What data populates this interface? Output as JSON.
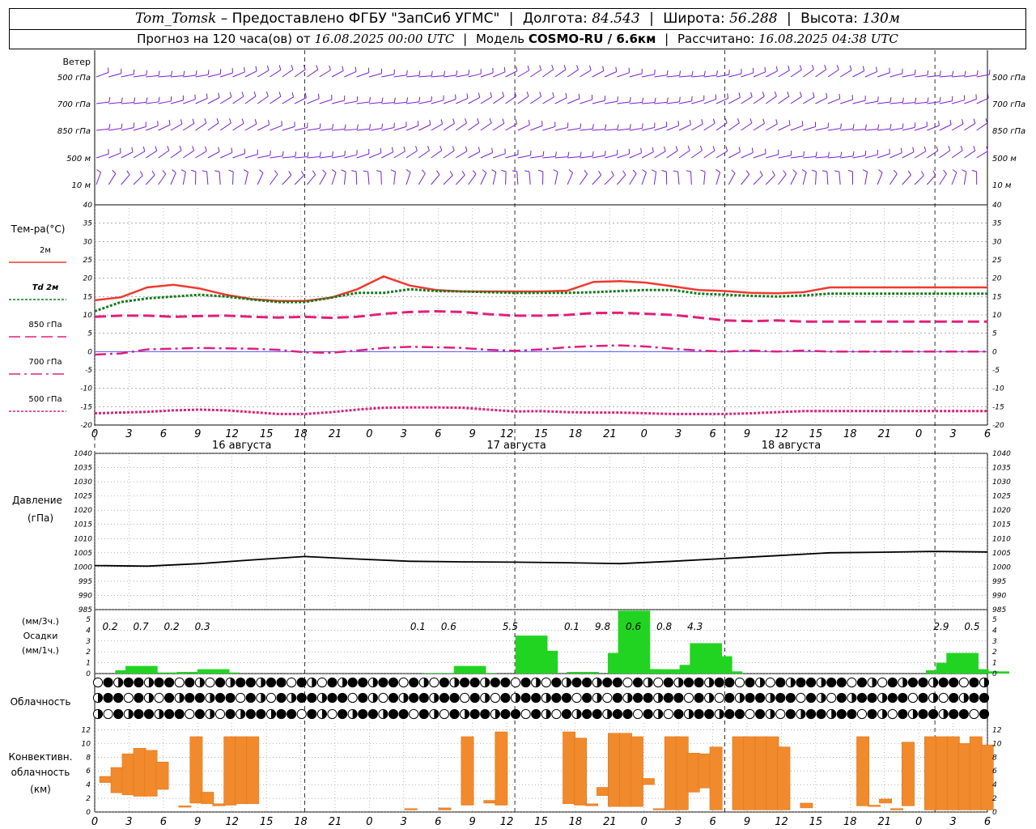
{
  "header": {
    "station": "Tom_Tomsk",
    "provider": "– Предоставлено ФГБУ \"ЗапСиб УГМС\"",
    "lon_label": "Долгота:",
    "lon": "84.543",
    "lat_label": "Широта:",
    "lat": "56.288",
    "alt_label": "Высота:",
    "alt": "130м",
    "forecast_text": "Прогноз на 120 часа(ов) от",
    "forecast_start": "16.08.2025 00:00 UTC",
    "model_label": "Модель",
    "model": "COSMO-RU / 6.6км",
    "calc_label": "Рассчитано:",
    "calc_time": "16.08.2025 04:38 UTC"
  },
  "panels": {
    "wind_label": "Ветер",
    "wind_levels": [
      "500 гПа",
      "700 гПа",
      "850 гПа",
      "500 м",
      "10  м"
    ],
    "temp_label": "Тем-ра(°C)",
    "temp_legend": [
      "2м",
      "Td  2м",
      "850 гПа",
      "700 гПа",
      "500 гПа"
    ],
    "pressure_label_1": "Давление",
    "pressure_label_2": "(гПа)",
    "precip_label_1": "(мм/3ч.)",
    "precip_label_2": "Осадки",
    "precip_label_3": "(мм/1ч.)",
    "cloud_label": "Облачность",
    "conv_label_1": "Конвективн.",
    "conv_label_2": "облачность",
    "conv_label_3": "(км)"
  },
  "colors": {
    "wind": "#7a1fd0",
    "t2m": "#ef3a2f",
    "td2m": "#157a1c",
    "t850": "#e0207a",
    "t700": "#e0207a",
    "t500": "#e0207a",
    "pressure": "#000000",
    "precip": "#22d422",
    "convective": "#f08a2c",
    "grid": "#808080",
    "zero_line": "#3b3bff"
  },
  "time_axis": {
    "tick_labels": [
      "0",
      "3",
      "6",
      "9",
      "12",
      "15",
      "18",
      "21",
      "0",
      "3",
      "6",
      "9",
      "12",
      "15",
      "18",
      "21",
      "0",
      "3",
      "6",
      "9",
      "12",
      "15",
      "18",
      "21",
      "0",
      "3",
      "6"
    ],
    "day_labels": [
      "16 августа",
      "17 августа",
      "18 августа"
    ]
  },
  "chart_data": [
    {
      "type": "line",
      "title": "Тем-ра(°C)",
      "x_hours": [
        0,
        3,
        6,
        9,
        12,
        15,
        18,
        21,
        24,
        27,
        30,
        33,
        36,
        39,
        42,
        45,
        48,
        51,
        54,
        57,
        60,
        63,
        66,
        69,
        72,
        75,
        78,
        81,
        84,
        87,
        90,
        93,
        96,
        99,
        102
      ],
      "ylim": [
        -20,
        40
      ],
      "yticks": [
        40,
        35,
        30,
        25,
        20,
        15,
        10,
        5,
        0,
        -5,
        -10,
        -15,
        -20
      ],
      "series": [
        {
          "name": "2м",
          "values": [
            14,
            14.8,
            17.5,
            18.2,
            17.2,
            15.5,
            14.3,
            13.8,
            13.8,
            14.7,
            17.0,
            20.5,
            18.0,
            16.8,
            16.4,
            16.4,
            16.4,
            16.4,
            16.6,
            19.0,
            19.2,
            18.8,
            17.8,
            16.8,
            16.5,
            16.0,
            15.9,
            16.2,
            17.5,
            17.5,
            17.5,
            17.5,
            17.5,
            17.5,
            17.5
          ]
        },
        {
          "name": "Td  2м",
          "values": [
            11,
            13.5,
            14.5,
            15.0,
            15.5,
            15.0,
            14.2,
            13.5,
            13.5,
            14.7,
            16.0,
            16.0,
            17.0,
            16.5,
            16.4,
            16.2,
            16.0,
            16.0,
            16.0,
            16.2,
            16.5,
            16.8,
            16.8,
            15.8,
            15.5,
            15.2,
            15.0,
            15.3,
            15.8,
            15.8,
            15.8,
            15.8,
            15.8,
            15.8,
            15.8
          ]
        },
        {
          "name": "850 гПа",
          "values": [
            9.5,
            9.8,
            9.8,
            9.5,
            9.7,
            9.8,
            9.5,
            9.3,
            9.5,
            9.2,
            9.5,
            10.3,
            10.8,
            11.0,
            10.8,
            10.2,
            9.8,
            9.8,
            10.0,
            10.5,
            10.6,
            10.3,
            10.0,
            9.3,
            8.5,
            8.3,
            8.5,
            8.2,
            8.2,
            8.2,
            8.2,
            8.2,
            8.2,
            8.2,
            8.2
          ]
        },
        {
          "name": "700 гПа",
          "values": [
            -0.8,
            -0.5,
            0.6,
            0.8,
            1.0,
            0.9,
            0.8,
            0.5,
            -0.2,
            -0.3,
            0.3,
            1.0,
            1.3,
            1.2,
            1.0,
            0.5,
            0.2,
            0.6,
            1.2,
            1.5,
            1.7,
            1.4,
            0.8,
            0.3,
            0,
            0.3,
            0,
            0.3,
            0,
            0,
            0,
            0,
            0,
            0,
            0
          ]
        },
        {
          "name": "500 гПа",
          "values": [
            -16.8,
            -16.6,
            -16.4,
            -16.0,
            -15.8,
            -16.0,
            -16.5,
            -17.0,
            -17.0,
            -16.5,
            -15.8,
            -15.3,
            -15.2,
            -15.2,
            -15.3,
            -15.8,
            -16.3,
            -16.2,
            -16.5,
            -16.6,
            -16.6,
            -16.8,
            -17.0,
            -17.0,
            -17.0,
            -16.8,
            -16.5,
            -16.2,
            -16.2,
            -16.2,
            -16.2,
            -16.2,
            -16.2,
            -16.2,
            -16.2
          ]
        }
      ]
    },
    {
      "type": "line",
      "title": "Давление",
      "x_hours": [
        0,
        6,
        12,
        18,
        24,
        30,
        36,
        42,
        48,
        54,
        60,
        66,
        72,
        78,
        84,
        90,
        96,
        102
      ],
      "ylim": [
        985,
        1040
      ],
      "yticks": [
        1040,
        1035,
        1030,
        1025,
        1020,
        1015,
        1010,
        1005,
        1000,
        995,
        990,
        985
      ],
      "series": [
        {
          "name": "Давление",
          "values": [
            1000.5,
            1000.3,
            1001.2,
            1002.5,
            1003.7,
            1002.8,
            1002.0,
            1001.8,
            1001.7,
            1001.5,
            1001.2,
            1002.0,
            1003.0,
            1004.0,
            1005.0,
            1005.2,
            1005.5,
            1005.3
          ]
        }
      ]
    },
    {
      "type": "bar",
      "title": "Осадки",
      "ylim": [
        0,
        5
      ],
      "yticks": [
        5,
        4,
        3,
        2,
        1,
        0
      ],
      "bars_mm_per_hour": [
        {
          "hour": 2,
          "value": 0.3
        },
        {
          "hour": 3,
          "value": 0.7
        },
        {
          "hour": 4,
          "value": 0.1
        },
        {
          "hour": 7,
          "value": 0.1
        },
        {
          "hour": 8,
          "value": 0.15
        },
        {
          "hour": 9,
          "value": 0.1
        },
        {
          "hour": 10,
          "value": 0.4
        },
        {
          "hour": 11,
          "value": 0.1
        },
        {
          "hour": 32,
          "value": 0.05
        },
        {
          "hour": 35,
          "value": 0.7
        },
        {
          "hour": 36,
          "value": 0.05
        },
        {
          "hour": 41,
          "value": 3.5
        },
        {
          "hour": 42,
          "value": 2.1
        },
        {
          "hour": 46,
          "value": 0.15
        },
        {
          "hour": 50,
          "value": 1.9
        },
        {
          "hour": 51,
          "value": 5.8
        },
        {
          "hour": 52,
          "value": 0.4
        },
        {
          "hour": 53,
          "value": 0.2
        },
        {
          "hour": 54,
          "value": 0.4
        },
        {
          "hour": 56,
          "value": 0.2
        },
        {
          "hour": 57,
          "value": 0.8
        },
        {
          "hour": 58,
          "value": 2.8
        },
        {
          "hour": 59,
          "value": 1.6
        },
        {
          "hour": 60,
          "value": 0.2
        },
        {
          "hour": 81,
          "value": 0.3
        },
        {
          "hour": 82,
          "value": 1.0
        },
        {
          "hour": 83,
          "value": 1.9
        },
        {
          "hour": 84,
          "value": 0.4
        },
        {
          "hour": 85,
          "value": 0.2
        },
        {
          "hour": 86,
          "value": 0.2
        }
      ],
      "sum_labels_mm_per_3h": [
        {
          "hour": 1.5,
          "text": "0.2"
        },
        {
          "hour": 4.5,
          "text": "0.7"
        },
        {
          "hour": 7.5,
          "text": "0.2"
        },
        {
          "hour": 10.5,
          "text": "0.3"
        },
        {
          "hour": 31.5,
          "text": "0.1"
        },
        {
          "hour": 34.5,
          "text": "0.6"
        },
        {
          "hour": 40.5,
          "text": "5.5"
        },
        {
          "hour": 46.5,
          "text": "0.1"
        },
        {
          "hour": 49.5,
          "text": "9.8"
        },
        {
          "hour": 52.5,
          "text": "0.6"
        },
        {
          "hour": 55.5,
          "text": "0.8"
        },
        {
          "hour": 58.5,
          "text": "4.3"
        },
        {
          "hour": 82.5,
          "text": "2.9"
        },
        {
          "hour": 85.5,
          "text": "0.5"
        }
      ]
    },
    {
      "type": "bar",
      "title": "Конвективн. облачность",
      "ylim": [
        0,
        13
      ],
      "yticks": [
        12,
        10,
        8,
        6,
        4,
        2,
        0
      ],
      "ranges_km": [
        {
          "hour": 0,
          "bottom": 4.3,
          "top": 5.2
        },
        {
          "hour": 1,
          "bottom": 2.8,
          "top": 6.5
        },
        {
          "hour": 2,
          "bottom": 2.5,
          "top": 8.5
        },
        {
          "hour": 3,
          "bottom": 2.3,
          "top": 9.3
        },
        {
          "hour": 4,
          "bottom": 2.3,
          "top": 9.0
        },
        {
          "hour": 5,
          "bottom": 3.3,
          "top": 7.3
        },
        {
          "hour": 7,
          "bottom": 0.7,
          "top": 0.9
        },
        {
          "hour": 8,
          "bottom": 1.3,
          "top": 11.0
        },
        {
          "hour": 9,
          "bottom": 1.2,
          "top": 2.9
        },
        {
          "hour": 10,
          "bottom": 0.9,
          "top": 1.2
        },
        {
          "hour": 11,
          "bottom": 1.0,
          "top": 11.0
        },
        {
          "hour": 12,
          "bottom": 1.2,
          "top": 11.0
        },
        {
          "hour": 13,
          "bottom": 1.2,
          "top": 11.0
        },
        {
          "hour": 27,
          "bottom": 0.3,
          "top": 0.5
        },
        {
          "hour": 30,
          "bottom": 0.3,
          "top": 0.6
        },
        {
          "hour": 32,
          "bottom": 1.0,
          "top": 11.0
        },
        {
          "hour": 34,
          "bottom": 1.3,
          "top": 1.7
        },
        {
          "hour": 35,
          "bottom": 1.0,
          "top": 11.7
        },
        {
          "hour": 41,
          "bottom": 1.2,
          "top": 11.7
        },
        {
          "hour": 42,
          "bottom": 1.0,
          "top": 10.8
        },
        {
          "hour": 43,
          "bottom": 0.9,
          "top": 1.2
        },
        {
          "hour": 44,
          "bottom": 2.4,
          "top": 3.6
        },
        {
          "hour": 45,
          "bottom": 0.8,
          "top": 11.5
        },
        {
          "hour": 46,
          "bottom": 0.8,
          "top": 11.5
        },
        {
          "hour": 47,
          "bottom": 0.8,
          "top": 11.0
        },
        {
          "hour": 48,
          "bottom": 4.0,
          "top": 4.9
        },
        {
          "hour": 49,
          "bottom": 0.3,
          "top": 0.5
        },
        {
          "hour": 50,
          "bottom": 0.3,
          "top": 11.0
        },
        {
          "hour": 51,
          "bottom": 0.3,
          "top": 11.0
        },
        {
          "hour": 52,
          "bottom": 2.9,
          "top": 8.6
        },
        {
          "hour": 53,
          "bottom": 3.5,
          "top": 8.5
        },
        {
          "hour": 54,
          "bottom": 0.3,
          "top": 9.5
        },
        {
          "hour": 56,
          "bottom": 0.3,
          "top": 11.0
        },
        {
          "hour": 57,
          "bottom": 0.3,
          "top": 11.0
        },
        {
          "hour": 58,
          "bottom": 0.3,
          "top": 11.0
        },
        {
          "hour": 59,
          "bottom": 0.3,
          "top": 11.0
        },
        {
          "hour": 60,
          "bottom": 0.3,
          "top": 9.5
        },
        {
          "hour": 62,
          "bottom": 0.6,
          "top": 1.3
        },
        {
          "hour": 67,
          "bottom": 0.9,
          "top": 11.0
        },
        {
          "hour": 68,
          "bottom": 0.8,
          "top": 1.0
        },
        {
          "hour": 69,
          "bottom": 1.3,
          "top": 1.9
        },
        {
          "hour": 70,
          "bottom": 0.3,
          "top": 0.5
        },
        {
          "hour": 71,
          "bottom": 0.9,
          "top": 10.2
        },
        {
          "hour": 73,
          "bottom": 0.3,
          "top": 11.0
        },
        {
          "hour": 74,
          "bottom": 0.3,
          "top": 11.0
        },
        {
          "hour": 75,
          "bottom": 0.3,
          "top": 11.0
        },
        {
          "hour": 76,
          "bottom": 0.3,
          "top": 10.0
        },
        {
          "hour": 77,
          "bottom": 0.3,
          "top": 11.0
        },
        {
          "hour": 78,
          "bottom": 0.3,
          "top": 9.8
        }
      ]
    }
  ]
}
